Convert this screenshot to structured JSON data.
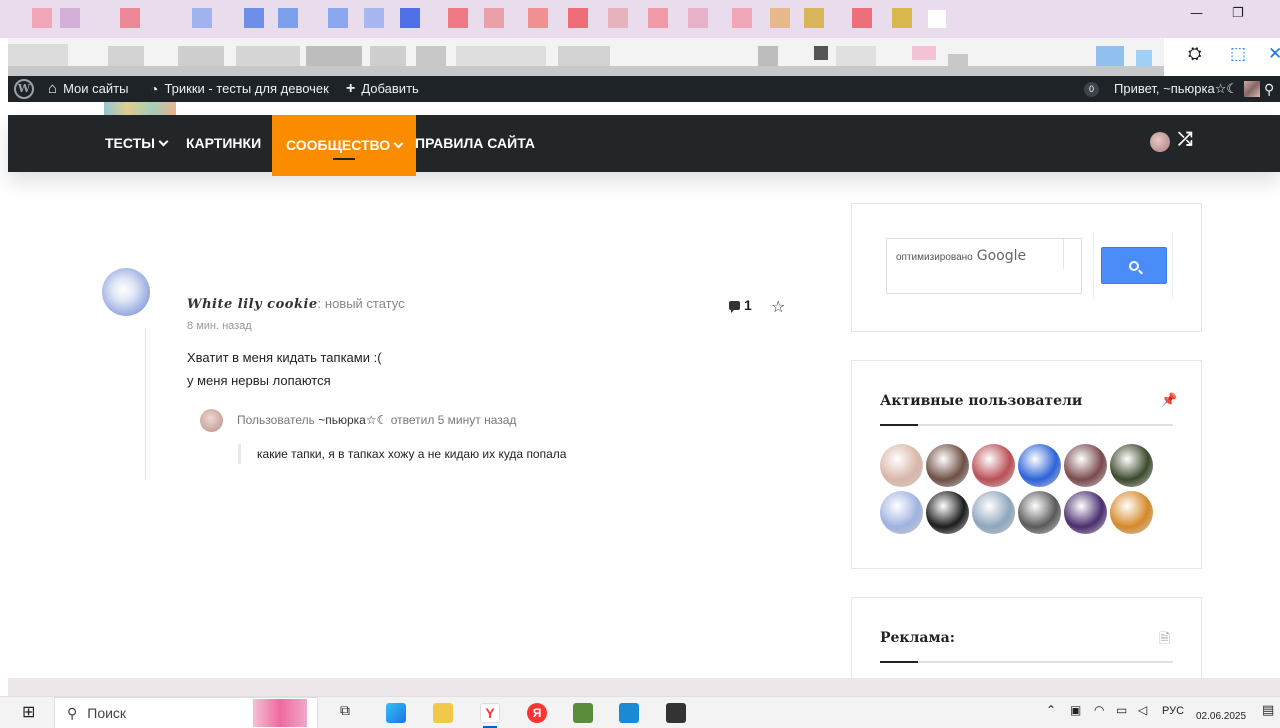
{
  "window": {
    "minimize_glyph": "—",
    "restore_glyph": "❐"
  },
  "adminbar": {
    "my_sites": "Мои сайты",
    "site_name": "Трикки - тесты для девочек",
    "add_new": "Добавить",
    "comments_count": "0",
    "greeting": "Привет, ~пьюрка☆☾"
  },
  "nav": {
    "items": [
      {
        "label": "ТЕСТЫ",
        "dropdown": true
      },
      {
        "label": "КАРТИНКИ",
        "dropdown": false
      },
      {
        "label": "СООБЩЕСТВО",
        "dropdown": true,
        "active": true
      },
      {
        "label": "ПРАВИЛА САЙТА",
        "dropdown": false
      }
    ],
    "accent": "#fb8c00"
  },
  "post": {
    "username": "White lily cookie",
    "action": ": новый статус",
    "time": "8 мин. назад",
    "comments": "1",
    "lines": [
      "Хватит в меня кидать тапками :(",
      "у меня нервы лопаются"
    ],
    "reply": {
      "prefix": "Пользователь",
      "author": "~пьюрка☆☾",
      "verb": "ответил",
      "time": "5 минут назад",
      "text": "какие тапки, я в тапках хожу а не кидаю их куда попала"
    }
  },
  "sidebar": {
    "search": {
      "label": "оптимизировано",
      "brand": "Google"
    },
    "active_users": {
      "title": "Активные пользователи",
      "avatar_colors": [
        "#d9b6a8",
        "#6e4f44",
        "#b94f56",
        "#2c63d9",
        "#7a4a4e",
        "#3c4a2e",
        "#9fb2e0",
        "#1c1c1c",
        "#8fa6bc",
        "#5a5a5a",
        "#4a2d6e",
        "#d58a2a"
      ]
    },
    "ads": {
      "title": "Реклама:"
    }
  },
  "taskbar": {
    "search_label": "Поиск",
    "lang": "РУС",
    "date": "02.06.2025"
  }
}
